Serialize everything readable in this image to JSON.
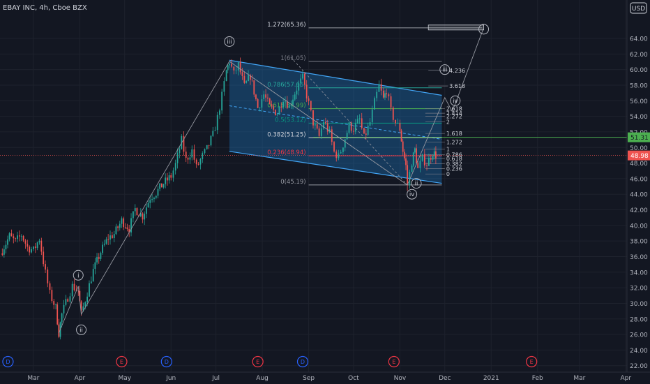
{
  "chart_data": {
    "type": "candlestick",
    "title": "EBAY INC, 4h, Cboe BZX",
    "currency": "USD",
    "ylim": [
      21,
      66.6
    ],
    "y_ticks": [
      22,
      24,
      26,
      28,
      30,
      32,
      34,
      36,
      38,
      40,
      42,
      44,
      46,
      48,
      50,
      52,
      54,
      56,
      58,
      60,
      62,
      64
    ],
    "x_ticks": [
      {
        "label": "Mar",
        "x": "2020-03-01"
      },
      {
        "label": "Apr",
        "x": "2020-04-01"
      },
      {
        "label": "May",
        "x": "2020-05-01"
      },
      {
        "label": "Jun",
        "x": "2020-06-01"
      },
      {
        "label": "Jul",
        "x": "2020-07-01"
      },
      {
        "label": "Aug",
        "x": "2020-08-01"
      },
      {
        "label": "Sep",
        "x": "2020-09-01"
      },
      {
        "label": "Oct",
        "x": "2020-10-01"
      },
      {
        "label": "Nov",
        "x": "2020-11-01"
      },
      {
        "label": "Dec",
        "x": "2020-12-01"
      },
      {
        "label": "2021",
        "x": "2021-01-01"
      },
      {
        "label": "Feb",
        "x": "2021-02-01"
      },
      {
        "label": "Mar",
        "x": "2021-03-01"
      },
      {
        "label": "Apr",
        "x": "2021-04-01"
      }
    ],
    "price_path": [
      {
        "date": "2020-02-08",
        "price": 36.4
      },
      {
        "date": "2020-02-14",
        "price": 38.6
      },
      {
        "date": "2020-02-18",
        "price": 37.9
      },
      {
        "date": "2020-02-22",
        "price": 38.8
      },
      {
        "date": "2020-02-26",
        "price": 37.2
      },
      {
        "date": "2020-03-01",
        "price": 36.8
      },
      {
        "date": "2020-03-05",
        "price": 38.3
      },
      {
        "date": "2020-03-09",
        "price": 33.9
      },
      {
        "date": "2020-03-12",
        "price": 31.2
      },
      {
        "date": "2020-03-16",
        "price": 29.4
      },
      {
        "date": "2020-03-18",
        "price": 26.2
      },
      {
        "date": "2020-03-20",
        "price": 28.6
      },
      {
        "date": "2020-03-24",
        "price": 30.8
      },
      {
        "date": "2020-03-27",
        "price": 32.2
      },
      {
        "date": "2020-03-31",
        "price": 31.6
      },
      {
        "date": "2020-04-02",
        "price": 28.6
      },
      {
        "date": "2020-04-06",
        "price": 31.4
      },
      {
        "date": "2020-04-10",
        "price": 34.2
      },
      {
        "date": "2020-04-15",
        "price": 36.6
      },
      {
        "date": "2020-04-20",
        "price": 38.4
      },
      {
        "date": "2020-04-24",
        "price": 38.9
      },
      {
        "date": "2020-04-29",
        "price": 40.6
      },
      {
        "date": "2020-05-04",
        "price": 39.6
      },
      {
        "date": "2020-05-08",
        "price": 42.1
      },
      {
        "date": "2020-05-13",
        "price": 41.2
      },
      {
        "date": "2020-05-18",
        "price": 43.6
      },
      {
        "date": "2020-05-22",
        "price": 44.2
      },
      {
        "date": "2020-05-27",
        "price": 45.4
      },
      {
        "date": "2020-06-01",
        "price": 46.3
      },
      {
        "date": "2020-06-04",
        "price": 47.8
      },
      {
        "date": "2020-06-08",
        "price": 50.9
      },
      {
        "date": "2020-06-11",
        "price": 48.4
      },
      {
        "date": "2020-06-15",
        "price": 49.6
      },
      {
        "date": "2020-06-18",
        "price": 47.4
      },
      {
        "date": "2020-06-22",
        "price": 48.9
      },
      {
        "date": "2020-06-25",
        "price": 49.8
      },
      {
        "date": "2020-06-29",
        "price": 51.6
      },
      {
        "date": "2020-07-02",
        "price": 53.8
      },
      {
        "date": "2020-07-05",
        "price": 56.6
      },
      {
        "date": "2020-07-08",
        "price": 59.8
      },
      {
        "date": "2020-07-10",
        "price": 61.05
      },
      {
        "date": "2020-07-13",
        "price": 59.4
      },
      {
        "date": "2020-07-16",
        "price": 60.6
      },
      {
        "date": "2020-07-20",
        "price": 57.8
      },
      {
        "date": "2020-07-24",
        "price": 59.2
      },
      {
        "date": "2020-07-29",
        "price": 55.1
      },
      {
        "date": "2020-08-02",
        "price": 56.8
      },
      {
        "date": "2020-08-06",
        "price": 55.2
      },
      {
        "date": "2020-08-11",
        "price": 54.4
      },
      {
        "date": "2020-08-15",
        "price": 56.4
      },
      {
        "date": "2020-08-19",
        "price": 55.3
      },
      {
        "date": "2020-08-24",
        "price": 57.6
      },
      {
        "date": "2020-08-28",
        "price": 58.9
      },
      {
        "date": "2020-09-01",
        "price": 55.6
      },
      {
        "date": "2020-09-04",
        "price": 53.2
      },
      {
        "date": "2020-09-08",
        "price": 51.4
      },
      {
        "date": "2020-09-11",
        "price": 53.4
      },
      {
        "date": "2020-09-15",
        "price": 51.8
      },
      {
        "date": "2020-09-18",
        "price": 49.4
      },
      {
        "date": "2020-09-21",
        "price": 48.8
      },
      {
        "date": "2020-09-24",
        "price": 50.4
      },
      {
        "date": "2020-09-28",
        "price": 52.8
      },
      {
        "date": "2020-10-01",
        "price": 52.4
      },
      {
        "date": "2020-10-05",
        "price": 53.6
      },
      {
        "date": "2020-10-08",
        "price": 51.2
      },
      {
        "date": "2020-10-12",
        "price": 53.2
      },
      {
        "date": "2020-10-15",
        "price": 55.8
      },
      {
        "date": "2020-10-18",
        "price": 57.9
      },
      {
        "date": "2020-10-21",
        "price": 56.2
      },
      {
        "date": "2020-10-23",
        "price": 57.4
      },
      {
        "date": "2020-10-26",
        "price": 54.6
      },
      {
        "date": "2020-10-29",
        "price": 53.2
      },
      {
        "date": "2020-11-01",
        "price": 52.4
      },
      {
        "date": "2020-11-03",
        "price": 49.6
      },
      {
        "date": "2020-11-05",
        "price": 47.6
      },
      {
        "date": "2020-11-06",
        "price": 45.19
      },
      {
        "date": "2020-11-09",
        "price": 48.2
      },
      {
        "date": "2020-11-11",
        "price": 49.7
      },
      {
        "date": "2020-11-13",
        "price": 47.2
      },
      {
        "date": "2020-11-16",
        "price": 48.6
      },
      {
        "date": "2020-11-19",
        "price": 47.9
      },
      {
        "date": "2020-11-23",
        "price": 49.4
      },
      {
        "date": "2020-11-25",
        "price": 48.98
      }
    ],
    "last_price": "48.98",
    "level_line": "51.31",
    "fibonacci_retracement": [
      {
        "label": "1(61.05)",
        "value": 61.05
      },
      {
        "label": "0.786(57.66)",
        "value": 57.66
      },
      {
        "label": "0.618(54.99)",
        "value": 54.99
      },
      {
        "label": "0.5(53.12)",
        "value": 53.12
      },
      {
        "label": "0.382(51.25)",
        "value": 51.25
      },
      {
        "label": "0.236(48.94)",
        "value": 48.94
      },
      {
        "label": "0(45.19)",
        "value": 45.19
      }
    ],
    "fibonacci_target": {
      "label": "1.272(65.36)",
      "value": 65.36
    },
    "fib_extension_labels": [
      "4.236",
      "3.618",
      "2.618",
      "2.414",
      "2.272",
      "2",
      "1.618",
      "1.272",
      "1",
      "0.786",
      "0.618",
      "0.382",
      "0.236",
      "0"
    ],
    "channel": {
      "upper": [
        {
          "date": "2020-07-10",
          "price": 61.2
        },
        {
          "date": "2020-11-29",
          "price": 56.7
        }
      ],
      "lower": [
        {
          "date": "2020-07-10",
          "price": 49.5
        },
        {
          "date": "2020-11-29",
          "price": 45.4
        }
      ]
    },
    "wave_labels": [
      {
        "text": "i",
        "date": "2020-03-31",
        "price": 33.6
      },
      {
        "text": "ii",
        "date": "2020-04-02",
        "price": 26.6
      },
      {
        "text": "iii",
        "date": "2020-07-10",
        "price": 63.6
      },
      {
        "text": "ii",
        "date": "2020-11-12",
        "price": 45.4
      },
      {
        "text": "iv",
        "date": "2020-11-09",
        "price": 44.0
      },
      {
        "text": "iii",
        "date": "2020-12-01",
        "price": 60.0
      },
      {
        "text": "iv",
        "date": "2020-12-08",
        "price": 56.0
      }
    ],
    "events": [
      {
        "text": "D",
        "date": "2020-02-13",
        "kind": "dividend"
      },
      {
        "text": "E",
        "date": "2020-04-29",
        "kind": "earnings"
      },
      {
        "text": "D",
        "date": "2020-05-29",
        "kind": "dividend"
      },
      {
        "text": "E",
        "date": "2020-07-29",
        "kind": "earnings"
      },
      {
        "text": "D",
        "date": "2020-08-28",
        "kind": "dividend"
      },
      {
        "text": "E",
        "date": "2020-10-28",
        "kind": "earnings"
      },
      {
        "text": "E",
        "date": "2021-01-28",
        "kind": "earnings"
      }
    ]
  }
}
